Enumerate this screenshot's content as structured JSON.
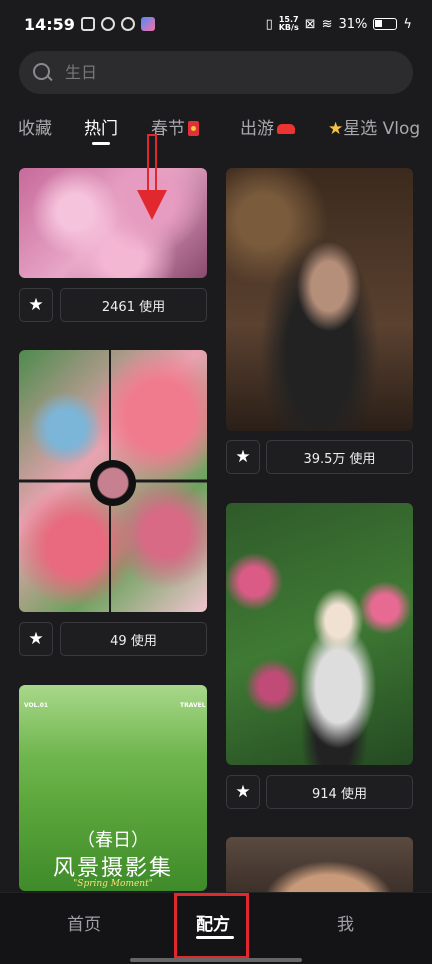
{
  "status_bar": {
    "time": "14:59",
    "speed_top": "15.7",
    "speed_unit": "KB/s",
    "battery": "31%"
  },
  "search": {
    "placeholder": "生日"
  },
  "tabs": [
    {
      "label": "收藏",
      "active": false
    },
    {
      "label": "热门",
      "active": true
    },
    {
      "label": "春节",
      "active": false
    },
    {
      "label": "出游",
      "active": false
    },
    {
      "label": "星选 Vlog",
      "active": false
    }
  ],
  "cards": [
    {
      "usage": "2461 使用",
      "image": "cherry-blossom-image"
    },
    {
      "usage": "39.5万 使用",
      "image": "cafe-portrait-image"
    },
    {
      "usage": "49 使用",
      "image": "tulip-collage-image"
    },
    {
      "usage": "914 使用",
      "image": "roses-portrait-image"
    },
    {
      "image": "spring-landscape-image",
      "title_line1": "（春日）",
      "title_line2": "风景摄影集",
      "subtitle": "\"Spring Moment\"",
      "badge_left": "VOL.01",
      "badge_right": "TRAVEL"
    },
    {
      "image": "portrait-partial-image"
    }
  ],
  "bottom_nav": [
    {
      "label": "首页",
      "active": false
    },
    {
      "label": "配方",
      "active": true
    },
    {
      "label": "我",
      "active": false
    }
  ],
  "colors": {
    "background": "#1b1b1d",
    "annotation_red": "#e0282e",
    "search_bg": "#2c2c2f"
  }
}
